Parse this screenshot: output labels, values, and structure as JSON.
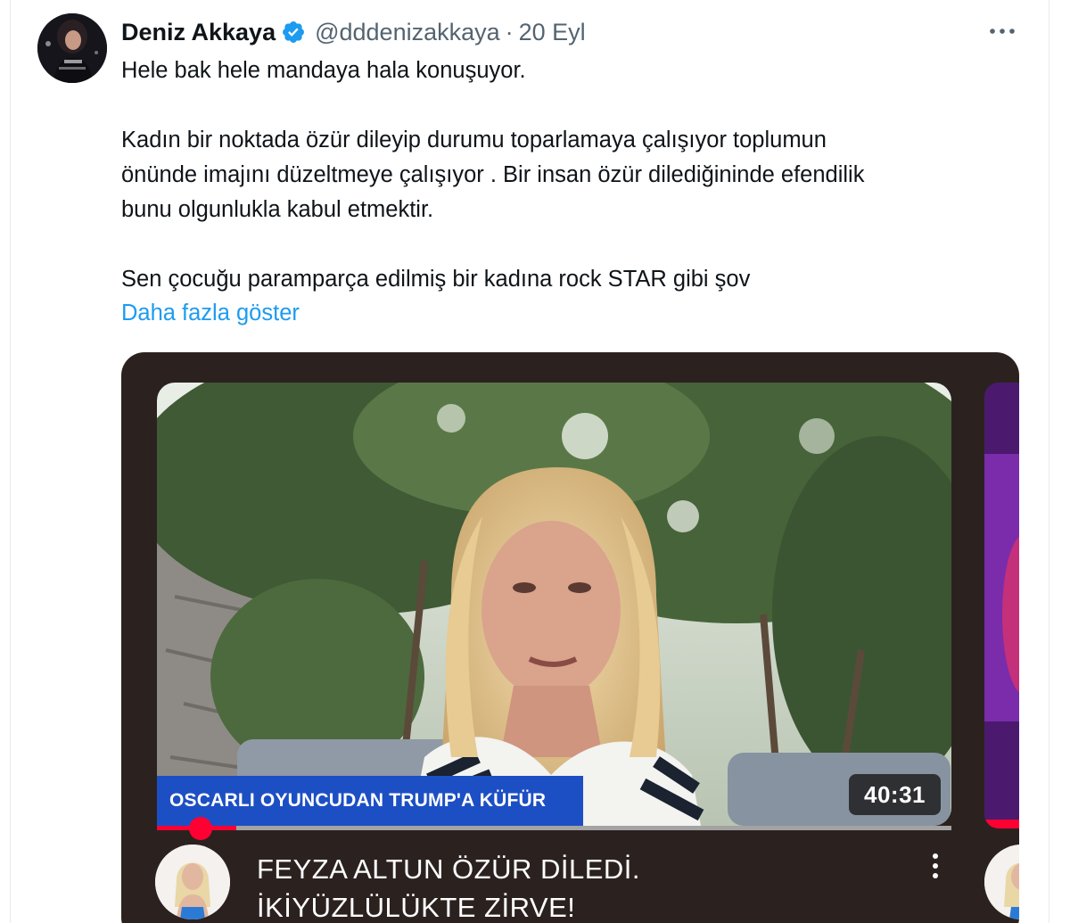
{
  "tweet": {
    "author_name": "Deniz Akkaya",
    "handle": "@dddenizakkaya",
    "separator": "·",
    "date": "20 Eyl",
    "more_icon": "more-horizontal-icon",
    "verified_icon": "verified-badge-icon",
    "verified_color": "#1d9bf0",
    "lines": [
      "Hele bak hele mandaya hala konuşuyor.",
      "Kadın bir noktada özür dileyip durumu toparlamaya çalışıyor toplumun",
      "önünde imajını düzeltmeye çalışıyor . Bir insan özür dilediğininde efendilik",
      "bunu olgunlukla kabul etmektir.",
      "Sen çocuğu paramparça edilmiş bir kadına rock STAR gibi şov"
    ],
    "show_more": "Daha fazla göster",
    "link_color": "#1d9bf0"
  },
  "video_card": {
    "banner": "OSCARLI OYUNCUDAN TRUMP'A KÜFÜR",
    "duration": "40:31",
    "progress": 0.1,
    "title_lines": [
      "FEYZA ALTUN ÖZÜR DİLEDİ.",
      "İKİYÜZLÜLÜKTE ZİRVE!"
    ],
    "menu_icon": "more-vertical-icon",
    "accent_color": "#ff0033",
    "banner_color": "#1d4fc4",
    "card_bg": "#2b2220"
  }
}
